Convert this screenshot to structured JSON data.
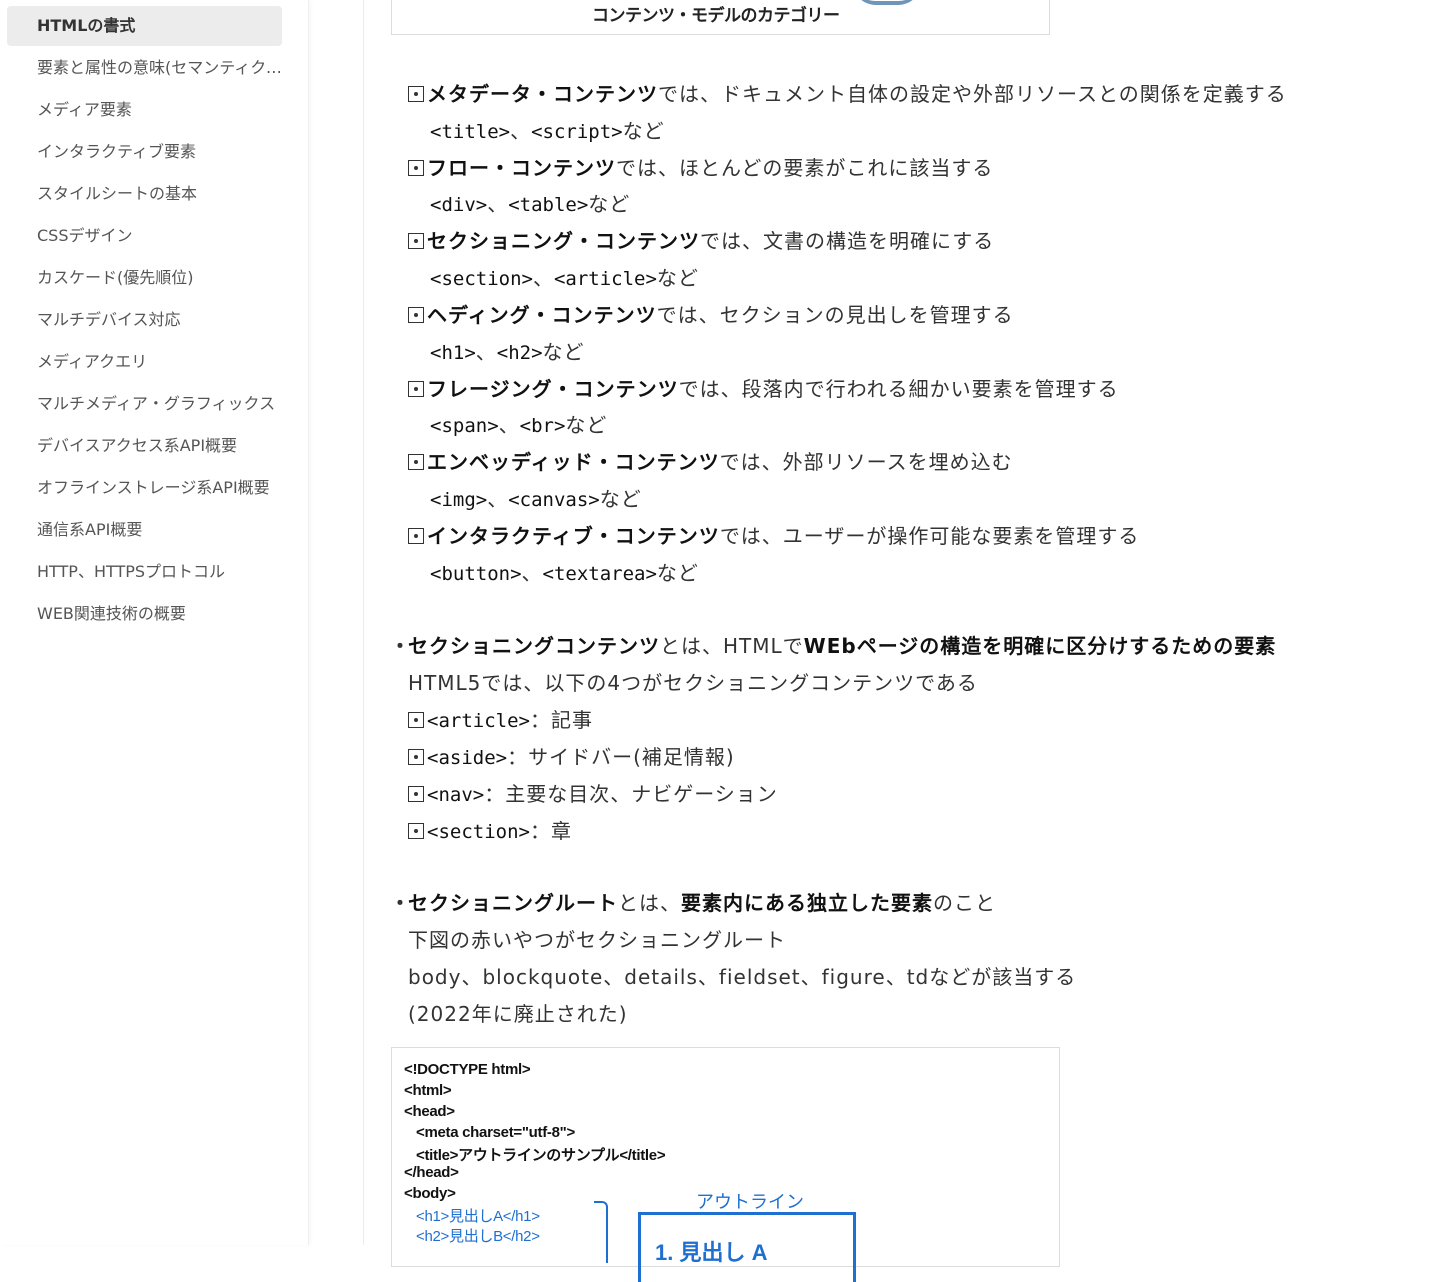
{
  "sidebar": {
    "items": [
      {
        "label": "HTMLの書式",
        "active": true
      },
      {
        "label": "要素と属性の意味(セマンティクス)"
      },
      {
        "label": "メディア要素"
      },
      {
        "label": "インタラクティブ要素"
      },
      {
        "label": "スタイルシートの基本"
      },
      {
        "label": "CSSデザイン"
      },
      {
        "label": "カスケード(優先順位)"
      },
      {
        "label": "マルチデバイス対応"
      },
      {
        "label": "メディアクエリ"
      },
      {
        "label": "マルチメディア・グラフィックス"
      },
      {
        "label": "デバイスアクセス系API概要"
      },
      {
        "label": "オフラインストレージ系API概要"
      },
      {
        "label": "通信系API概要"
      },
      {
        "label": "HTTP、HTTPSプロトコル"
      },
      {
        "label": "WEB関連技術の概要"
      }
    ]
  },
  "top_figure": {
    "caption": "コンテンツ・モデルのカテゴリー"
  },
  "categories": [
    {
      "name": "メタデータ・コンテンツ",
      "desc": "では、ドキュメント自体の設定や外部リソースとの関係を定義する",
      "ex1": "<title>",
      "ex2": "<script>"
    },
    {
      "name": "フロー・コンテンツ",
      "desc": "では、ほとんどの要素がこれに該当する",
      "ex1": "<div>",
      "ex2": "<table>"
    },
    {
      "name": "セクショニング・コンテンツ",
      "desc": "では、文書の構造を明確にする",
      "ex1": "<section>",
      "ex2": "<article>"
    },
    {
      "name": "ヘディング・コンテンツ",
      "desc": "では、セクションの見出しを管理する",
      "ex1": "<h1>",
      "ex2": "<h2>"
    },
    {
      "name": "フレージング・コンテンツ",
      "desc": "では、段落内で行われる細かい要素を管理する",
      "ex1": "<span>",
      "ex2": "<br>"
    },
    {
      "name": "エンベッディッド・コンテンツ",
      "desc": "では、外部リソースを埋め込む",
      "ex1": "<img>",
      "ex2": "<canvas>"
    },
    {
      "name": "インタラクティブ・コンテンツ",
      "desc": "では、ユーザーが操作可能な要素を管理する",
      "ex1": "<button>",
      "ex2": "<textarea>"
    }
  ],
  "common": {
    "sep": "、",
    "etc": "など",
    "bullet": "・"
  },
  "sectioning": {
    "term": "セクショニングコンテンツ",
    "mid": "とは、HTMLで",
    "def": "WEbページの構造を明確に区分けするための要素",
    "intro": "HTML5では、以下の4つがセクショニングコンテンツである",
    "items": [
      {
        "tag": "<article>",
        "desc": "：記事"
      },
      {
        "tag": "<aside>",
        "desc": "：サイドバー(補足情報)"
      },
      {
        "tag": "<nav>",
        "desc": "：主要な目次、ナビゲーション"
      },
      {
        "tag": "<section>",
        "desc": "：章"
      }
    ]
  },
  "root": {
    "term": "セクショニングルート",
    "mid": "とは、",
    "def": "要素内にある独立した要素",
    "end": "のこと",
    "line2": "下図の赤いやつがセクショニングルート",
    "line3": "body、blockquote、details、fieldset、figure、tdなどが該当する",
    "line4": "(2022年に廃止された)"
  },
  "code_figure": {
    "lines": [
      "<!DOCTYPE html>",
      "<html>",
      "<head>",
      "<meta charset=\"utf-8\">",
      "<title>アウトラインのサンプル</title>",
      "</head>",
      "<body>",
      "<h1>見出しA</h1>",
      "<h2>見出しB</h2>"
    ],
    "outline_label": "アウトライン",
    "outline_text": "1. 見出し A"
  }
}
